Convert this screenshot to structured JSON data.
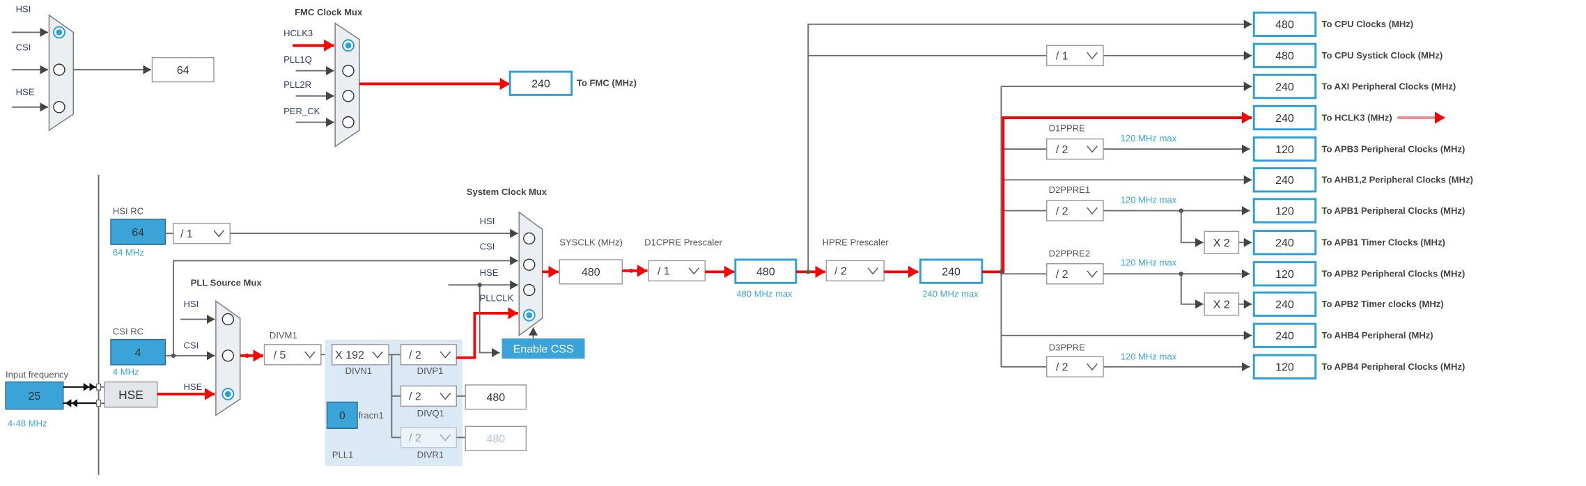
{
  "colors": {
    "accent": "#2a9fd8",
    "input_fill": "#3aa3d8",
    "wire": "#6b6b6b",
    "active_wire": "#ff0000",
    "pll_panel": "#dbe9f6",
    "input_label": "#2e3d75"
  },
  "top_mux": {
    "inputs": [
      "HSI",
      "CSI",
      "HSE"
    ],
    "selected": "HSI",
    "output": "64"
  },
  "fmc_mux": {
    "title": "FMC Clock Mux",
    "inputs": [
      "HCLK3",
      "PLL1Q",
      "PLL2R",
      "PER_CK"
    ],
    "selected": "HCLK3",
    "output": "240",
    "output_label": "To FMC (MHz)"
  },
  "hsi_rc": {
    "label": "HSI RC",
    "value": "64",
    "freq": "64 MHz",
    "divider": "/ 1"
  },
  "csi_rc": {
    "label": "CSI RC",
    "value": "4",
    "freq": "4 MHz"
  },
  "input_frequency": {
    "label": "Input frequency",
    "value": "25",
    "range": "4-48 MHz"
  },
  "hse": {
    "label": "HSE"
  },
  "pll_source_mux": {
    "title": "PLL Source Mux",
    "inputs": [
      "HSI",
      "CSI",
      "HSE"
    ],
    "selected": "HSE"
  },
  "pll1": {
    "label": "PLL1",
    "divm1": {
      "label": "DIVM1",
      "value": "/ 5"
    },
    "divn1": {
      "label": "DIVN1",
      "value": "X 192"
    },
    "fracn1": {
      "label": "fracn1",
      "value": "0"
    },
    "divp1": {
      "label": "DIVP1",
      "value": "/ 2"
    },
    "divq1": {
      "label": "DIVQ1",
      "value": "/ 2",
      "output": "480"
    },
    "divr1": {
      "label": "DIVR1",
      "value": "/ 2",
      "output": "480",
      "enabled": false
    }
  },
  "system_clock_mux": {
    "title": "System Clock Mux",
    "inputs": [
      "HSI",
      "CSI",
      "HSE",
      "PLLCLK"
    ],
    "selected": "PLLCLK",
    "enable_css": "Enable CSS"
  },
  "sysclk": {
    "label": "SYSCLK (MHz)",
    "value": "480"
  },
  "d1cpre": {
    "label": "D1CPRE Prescaler",
    "value": "/ 1",
    "output": "480",
    "max": "480 MHz max"
  },
  "hpre": {
    "label": "HPRE Prescaler",
    "value": "/ 2",
    "output": "240",
    "max": "240 MHz max"
  },
  "prescalers": {
    "systick": {
      "value": "/ 1"
    },
    "d1ppre": {
      "label": "D1PPRE",
      "value": "/ 2",
      "max": "120 MHz max"
    },
    "d2ppre1": {
      "label": "D2PPRE1",
      "value": "/ 2",
      "max": "120 MHz max",
      "timer_mult": "X 2"
    },
    "d2ppre2": {
      "label": "D2PPRE2",
      "value": "/ 2",
      "max": "120 MHz max",
      "timer_mult": "X 2"
    },
    "d3ppre": {
      "label": "D3PPRE",
      "value": "/ 2",
      "max": "120 MHz max"
    }
  },
  "outputs": [
    {
      "value": "480",
      "label": "To CPU Clocks (MHz)"
    },
    {
      "value": "480",
      "label": "To CPU Systick Clock (MHz)"
    },
    {
      "value": "240",
      "label": "To AXI Peripheral Clocks (MHz)"
    },
    {
      "value": "240",
      "label": "To HCLK3 (MHz)"
    },
    {
      "value": "120",
      "label": "To APB3 Peripheral Clocks (MHz)"
    },
    {
      "value": "240",
      "label": "To AHB1,2 Peripheral Clocks (MHz)"
    },
    {
      "value": "120",
      "label": "To APB1 Peripheral Clocks (MHz)"
    },
    {
      "value": "240",
      "label": "To APB1 Timer Clocks (MHz)"
    },
    {
      "value": "120",
      "label": "To APB2 Peripheral Clocks (MHz)"
    },
    {
      "value": "240",
      "label": "To APB2 Timer clocks (MHz)"
    },
    {
      "value": "240",
      "label": "To AHB4 Peripheral (MHz)"
    },
    {
      "value": "120",
      "label": "To APB4 Peripheral Clocks (MHz)"
    }
  ]
}
